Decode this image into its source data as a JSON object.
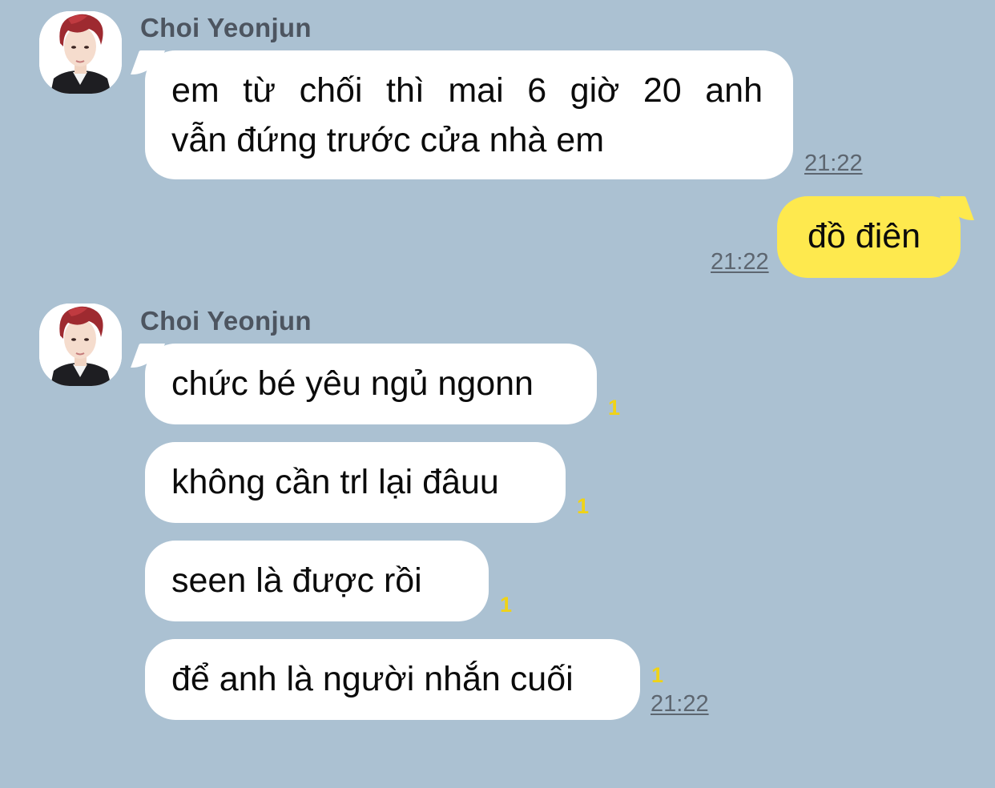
{
  "chat": {
    "incoming_sender": "Choi Yeonjun",
    "group1": {
      "message_line1": "em từ chối thì mai 6 giờ 20 anh",
      "message_line2": "vẫn đứng trước cửa nhà em",
      "time": "21:22"
    },
    "outgoing": {
      "message": "đồ điên",
      "time": "21:22"
    },
    "group2": {
      "messages": [
        {
          "text": "chức bé yêu ngủ ngonn",
          "unread": "1"
        },
        {
          "text": "không cần trl lại đâuu",
          "unread": "1"
        },
        {
          "text": "seen là được rồi",
          "unread": "1"
        },
        {
          "text": "để anh là người nhắn cuối",
          "unread": "1"
        }
      ],
      "time": "21:22"
    }
  },
  "icons": {
    "avatar": "profile-photo-red-hair"
  },
  "colors": {
    "background": "#abc1d2",
    "incoming_bubble": "#ffffff",
    "outgoing_bubble": "#fee94e",
    "unread_count": "#f0d316",
    "timestamp": "#5d6670",
    "sender_name": "#4d5560"
  }
}
